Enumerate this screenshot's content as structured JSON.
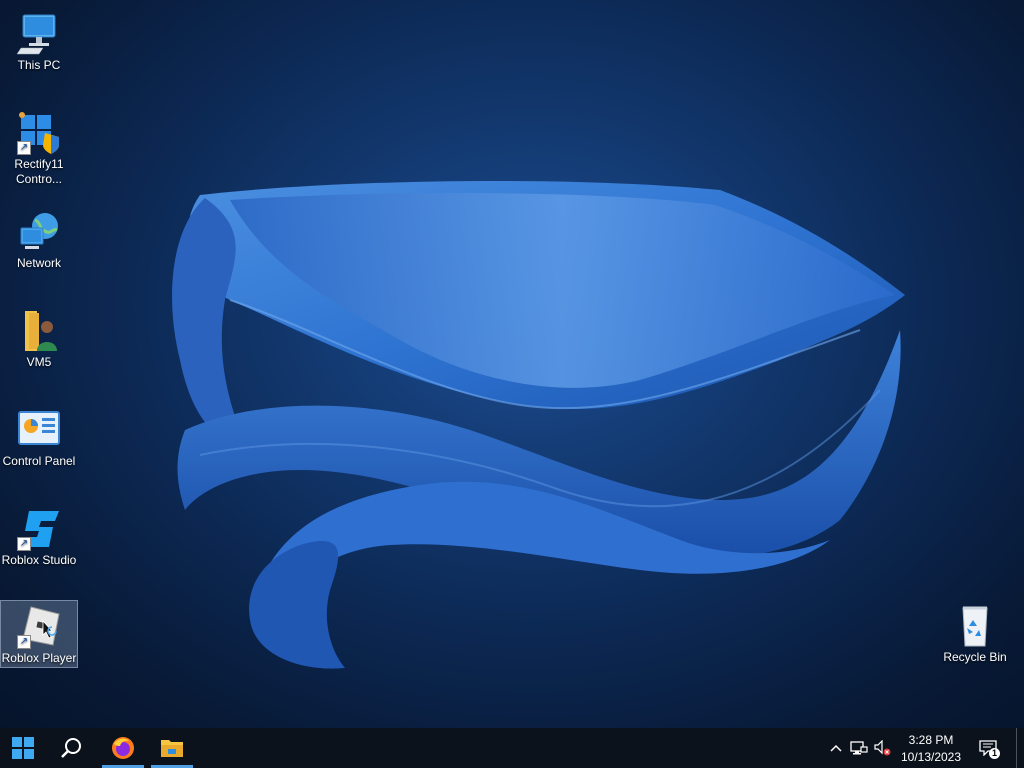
{
  "desktop": {
    "icons": [
      {
        "label": "This PC"
      },
      {
        "label": "Rectify11\nContro..."
      },
      {
        "label": "Network"
      },
      {
        "label": "VM5"
      },
      {
        "label": "Control Panel"
      },
      {
        "label": "Roblox Studio"
      },
      {
        "label": "Roblox Player"
      },
      {
        "label": "Recycle Bin"
      }
    ]
  },
  "taskbar": {
    "clock": {
      "time": "3:28 PM",
      "date": "10/13/2023"
    },
    "notification_count": "1",
    "accent_color": "#4f9fe5"
  }
}
